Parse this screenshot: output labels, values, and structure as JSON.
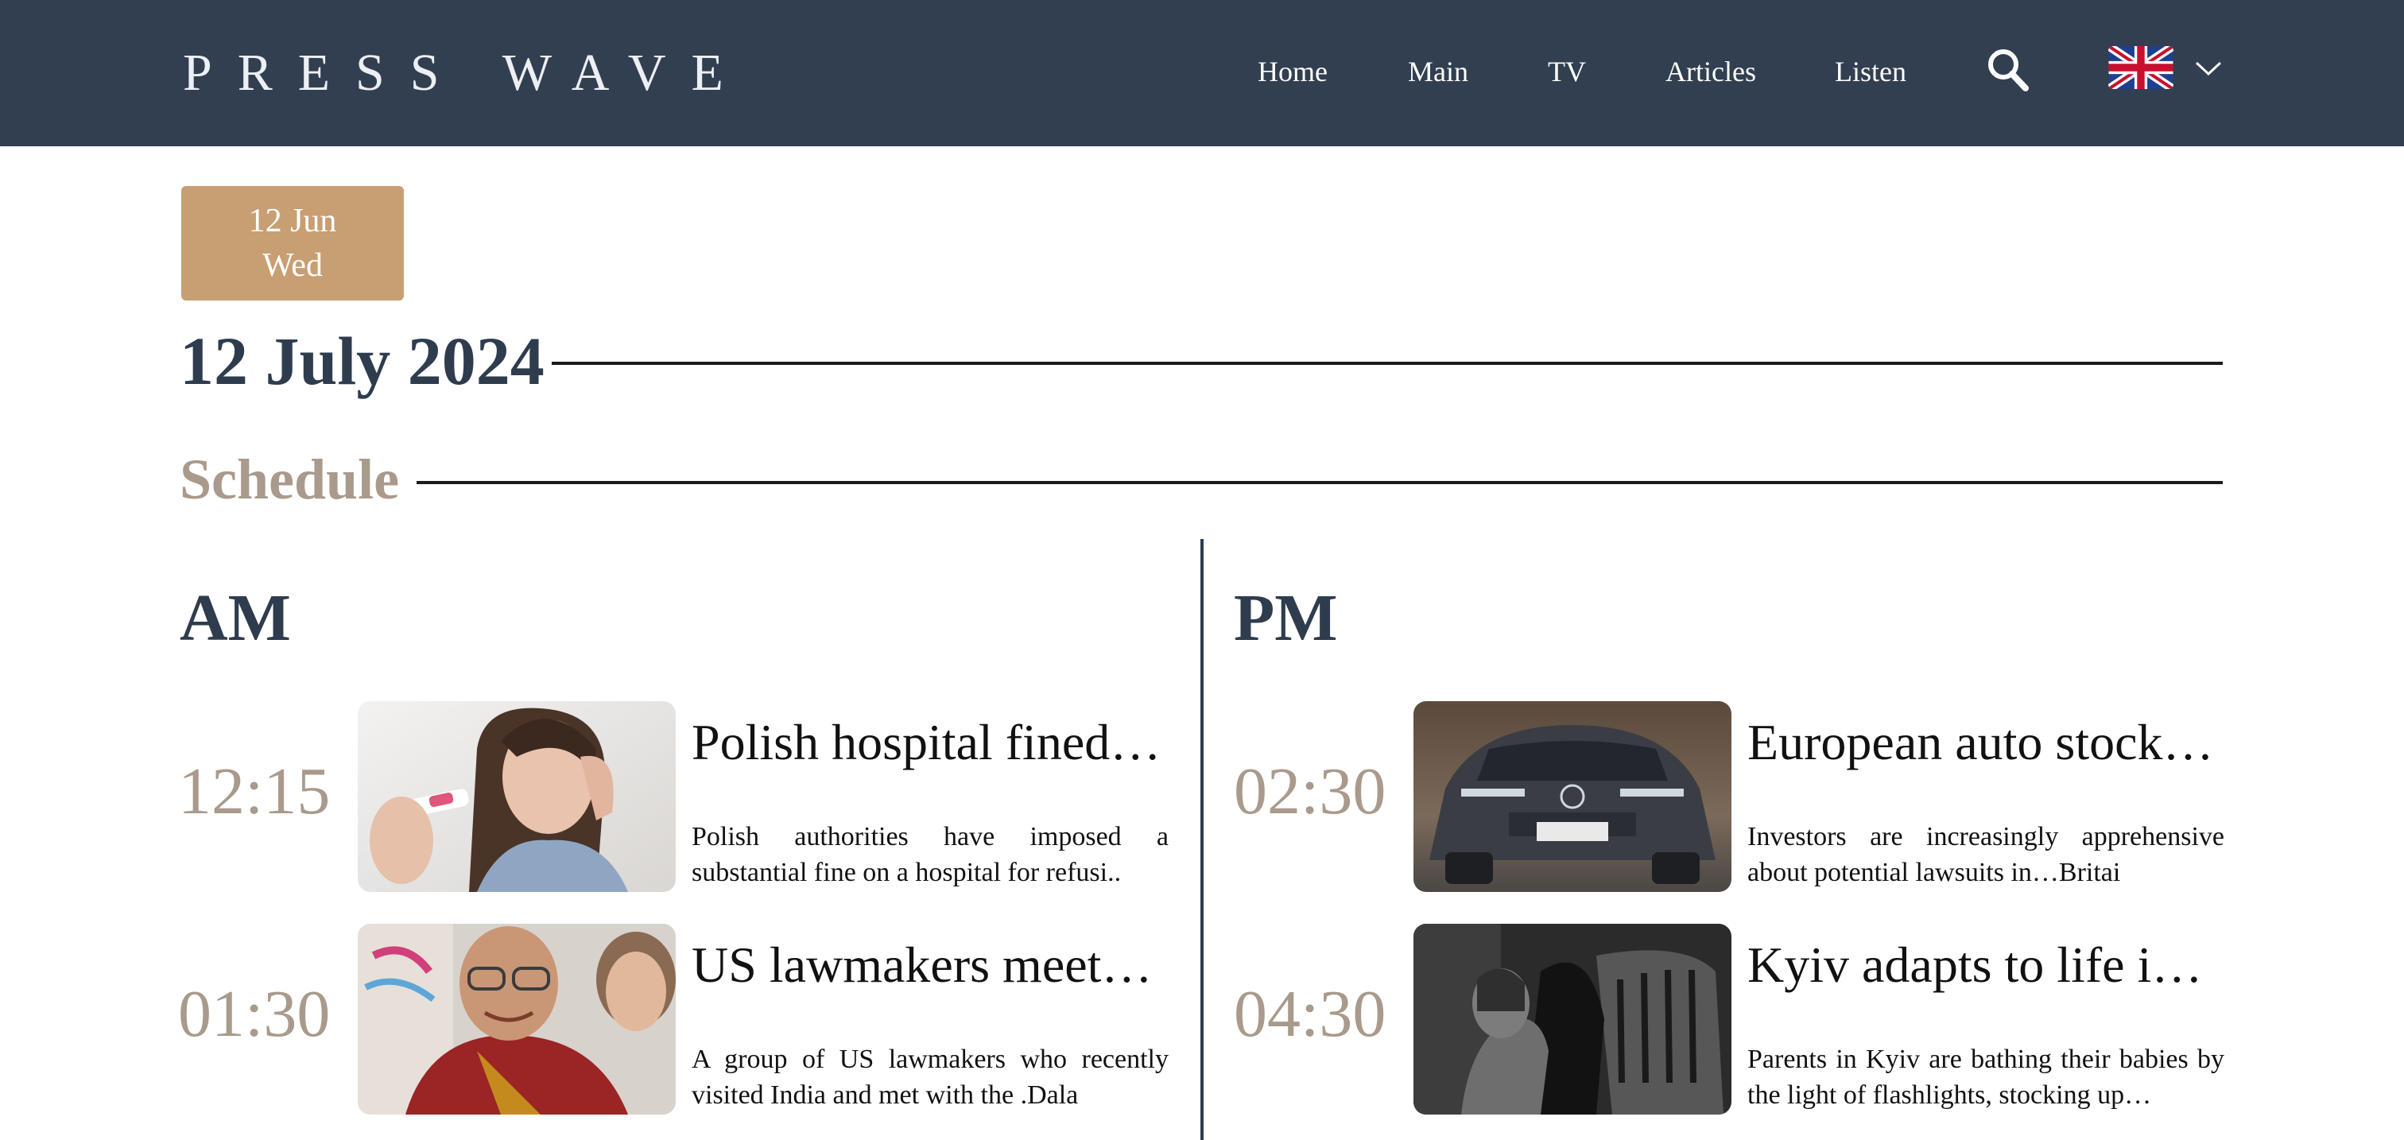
{
  "header": {
    "logo": "PRESS WAVE",
    "nav": [
      "Home",
      "Main",
      "TV",
      "Articles",
      "Listen"
    ],
    "search_icon": "search-icon",
    "language": {
      "flag": "uk-flag-icon",
      "chevron": "chevron-down-icon"
    }
  },
  "date_badge": {
    "day": "12 Jun",
    "weekday": "Wed"
  },
  "page_title": "12 July 2024",
  "section_title": "Schedule",
  "colors": {
    "header_bg": "#323f50",
    "accent_tan": "#c89f72",
    "muted_taupe": "#a99a8c",
    "navy_text": "#2e3c4e"
  },
  "am": {
    "label": "AM",
    "articles": [
      {
        "time": "12:15",
        "headline": "Polish hospital fined…",
        "summary": "Polish authorities have imposed a substantial fine on a hospital for refusi..",
        "image": "woman-with-pregnancy-test-photo"
      },
      {
        "time": "01:30",
        "headline": "US lawmakers meet…",
        "summary": "A group of US lawmakers who recently visited India and met with the .Dala",
        "image": "dalai-lama-photo"
      }
    ]
  },
  "pm": {
    "label": "PM",
    "articles": [
      {
        "time": "02:30",
        "headline": "European auto stock…",
        "summary": "Investors are increasingly apprehensive about potential lawsuits in…Britai",
        "image": "dark-suv-touareg-photo"
      },
      {
        "time": "04:30",
        "headline": "Kyiv adapts to life i…",
        "summary": "Parents in Kyiv are bathing their babies by the light of flashlights, stocking up…",
        "image": "woman-in-dark-shadow-photo"
      }
    ]
  }
}
